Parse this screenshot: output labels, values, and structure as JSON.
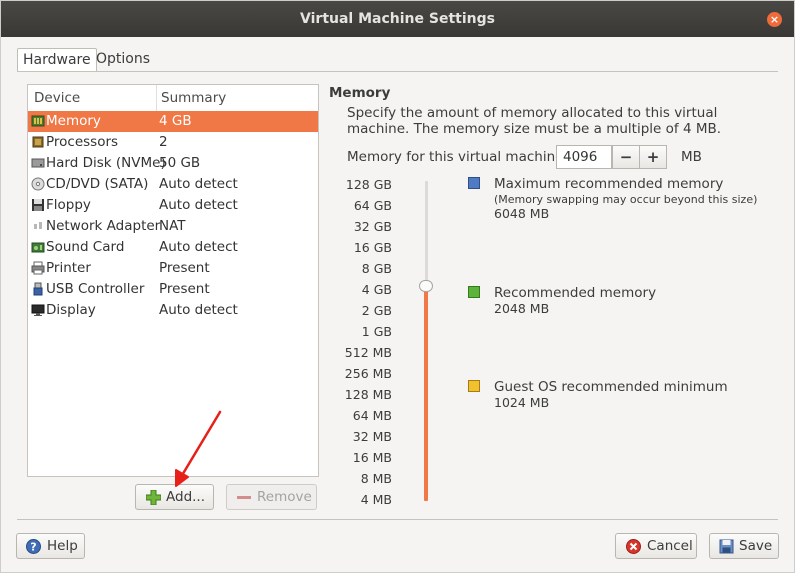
{
  "window": {
    "title": "Virtual Machine Settings",
    "close_glyph": "×"
  },
  "tabs": [
    {
      "label": "Hardware"
    },
    {
      "label": "Options"
    }
  ],
  "device_list": {
    "columns": [
      "Device",
      "Summary"
    ],
    "rows": [
      {
        "device": "Memory",
        "summary": "4 GB",
        "icon": "memory-icon"
      },
      {
        "device": "Processors",
        "summary": "2",
        "icon": "processor-icon"
      },
      {
        "device": "Hard Disk (NVMe)",
        "summary": "50 GB",
        "icon": "hard-disk-icon"
      },
      {
        "device": "CD/DVD (SATA)",
        "summary": "Auto detect",
        "icon": "cd-dvd-icon"
      },
      {
        "device": "Floppy",
        "summary": "Auto detect",
        "icon": "floppy-icon"
      },
      {
        "device": "Network Adapter",
        "summary": "NAT",
        "icon": "network-icon"
      },
      {
        "device": "Sound Card",
        "summary": "Auto detect",
        "icon": "sound-card-icon"
      },
      {
        "device": "Printer",
        "summary": "Present",
        "icon": "printer-icon"
      },
      {
        "device": "USB Controller",
        "summary": "Present",
        "icon": "usb-icon"
      },
      {
        "device": "Display",
        "summary": "Auto detect",
        "icon": "display-icon"
      }
    ],
    "selected": "Memory"
  },
  "list_buttons": {
    "add": "Add...",
    "remove": "Remove"
  },
  "memory": {
    "title": "Memory",
    "description": "Specify the amount of memory allocated to this virtual machine. The memory size must be a multiple of 4 MB.",
    "field_label": "Memory for this virtual machine:",
    "value": "4096",
    "unit": "MB",
    "decrement": "−",
    "increment": "+",
    "scale": [
      "128 GB",
      "64 GB",
      "32 GB",
      "16 GB",
      "8 GB",
      "4 GB",
      "2 GB",
      "1 GB",
      "512 MB",
      "256 MB",
      "128 MB",
      "64 MB",
      "32 MB",
      "16 MB",
      "8 MB",
      "4 MB"
    ],
    "legend": {
      "max": {
        "title": "Maximum recommended memory",
        "note": "(Memory swapping may occur beyond this size)",
        "value": "6048 MB",
        "color": "#4f7bc4"
      },
      "recommended": {
        "title": "Recommended memory",
        "value": "2048 MB",
        "color": "#5bb33a"
      },
      "minimum": {
        "title": "Guest OS recommended minimum",
        "value": "1024 MB",
        "color": "#f2c12e"
      }
    },
    "slider_color": "#f07746"
  },
  "footer": {
    "help": "Help",
    "cancel": "Cancel",
    "save": "Save"
  },
  "colors": {
    "accent": "#f07746",
    "annotation_arrow": "#e8201a"
  }
}
